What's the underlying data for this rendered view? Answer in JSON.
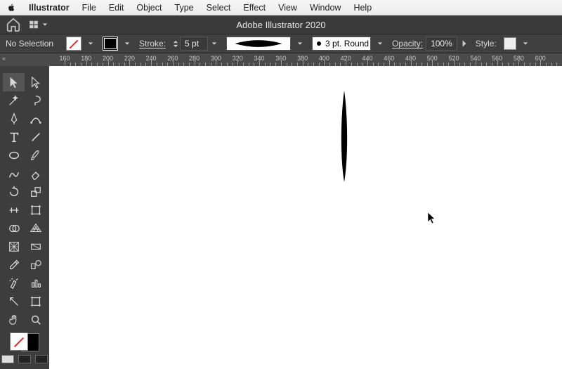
{
  "menubar": {
    "app": "Illustrator",
    "items": [
      "File",
      "Edit",
      "Object",
      "Type",
      "Select",
      "Effect",
      "View",
      "Window",
      "Help"
    ]
  },
  "titlebar": {
    "app_title": "Adobe Illustrator 2020"
  },
  "controlbar": {
    "selection": "No Selection",
    "stroke_label": "Stroke:",
    "stroke_width": "5 pt",
    "brush_def": "3 pt. Round",
    "opacity_label": "Opacity:",
    "opacity_value": "100%",
    "style_label": "Style:"
  },
  "ruler": {
    "start": 160,
    "end": 600,
    "step": 20,
    "first_tick_x": 92
  },
  "tools": {
    "rows": [
      [
        "selection-tool",
        "direct-selection-tool"
      ],
      [
        "magic-wand-tool",
        "lasso-tool"
      ],
      [
        "pen-tool",
        "curvature-tool"
      ],
      [
        "type-tool",
        "line-segment-tool"
      ],
      [
        "ellipse-tool",
        "paintbrush-tool"
      ],
      [
        "shaper-tool",
        "eraser-tool"
      ],
      [
        "rotate-tool",
        "scale-tool"
      ],
      [
        "width-tool",
        "free-transform-tool"
      ],
      [
        "shape-builder-tool",
        "perspective-grid-tool"
      ],
      [
        "mesh-tool",
        "gradient-tool"
      ],
      [
        "eyedropper-tool",
        "blend-tool"
      ],
      [
        "symbol-sprayer-tool",
        "column-graph-tool"
      ],
      [
        "slice-tool",
        "artboard-tool"
      ],
      [
        "hand-tool",
        "zoom-tool"
      ]
    ],
    "selected": "selection-tool"
  },
  "colors": {
    "accent_red": "#e03030",
    "panel": "#3d3d3d"
  }
}
